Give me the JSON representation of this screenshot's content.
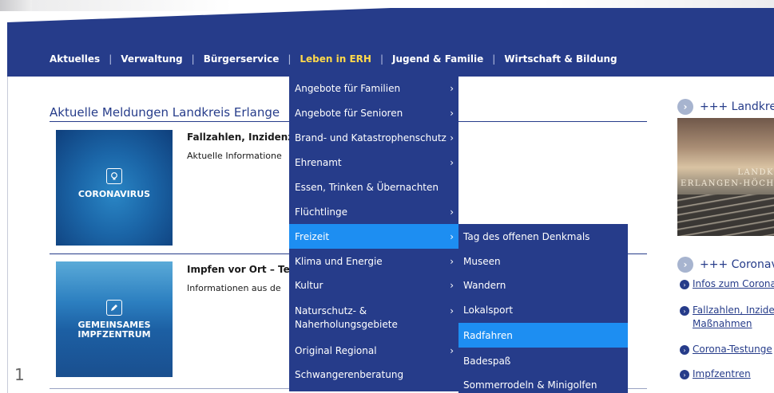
{
  "top_nav": {
    "items": [
      "Aktuelles",
      "Verwaltung",
      "Bürgerservice",
      "Leben in ERH",
      "Jugend & Familie",
      "Wirtschaft & Bildung"
    ],
    "active": "Leben in ERH",
    "separator": "|"
  },
  "main": {
    "heading": "Aktuelle Meldungen Landkreis Erlange",
    "news": [
      {
        "title": "Fallzahlen, Inzidenz",
        "text": "Aktuelle Informatione",
        "image_label": "CORONAVIRUS"
      },
      {
        "title": "Impfen vor Ort – Te",
        "text": "Informationen aus de",
        "image_label_line1": "GEMEINSAMES",
        "image_label_line2": "IMPFZENTRUM"
      }
    ],
    "page_number": "1"
  },
  "dropdown": {
    "items": [
      {
        "label": "Angebote für Familien",
        "arrow": "›"
      },
      {
        "label": "Angebote für Senioren",
        "arrow": "›"
      },
      {
        "label": "Brand- und Katastrophenschutz",
        "arrow": "›"
      },
      {
        "label": "Ehrenamt",
        "arrow": "›"
      },
      {
        "label": "Essen, Trinken & Übernachten",
        "arrow": ""
      },
      {
        "label": "Flüchtlinge",
        "arrow": "›"
      },
      {
        "label": "Freizeit",
        "arrow": "›"
      },
      {
        "label": "Klima und Energie",
        "arrow": "›"
      },
      {
        "label": "Kultur",
        "arrow": "›"
      },
      {
        "label": "Naturschutz- &",
        "label2": "Naherholungsgebiete",
        "arrow": "›"
      },
      {
        "label": "Original Regional",
        "arrow": "›"
      },
      {
        "label": "Schwangerenberatung",
        "arrow": ""
      }
    ],
    "highlighted": "Freizeit"
  },
  "submenu": {
    "items": [
      "Tag des offenen Denkmals",
      "Museen",
      "Wandern",
      "Lokalsport",
      "Radfahren",
      "Badespaß",
      "Sommerrodeln & Minigolfen"
    ],
    "highlighted": "Radfahren"
  },
  "right_column": {
    "heading1": "+++ Landkrei",
    "teaser_line1": "LANDK",
    "teaser_line2": "ERLANGEN-HÖCHS",
    "heading2": "+++ Coronavi",
    "links": [
      {
        "text": "Infos zum Corona"
      },
      {
        "text": "Fallzahlen, Inzide",
        "text2": "Maßnahmen"
      },
      {
        "text": "Corona-Testunge"
      },
      {
        "text": "Impfzentren"
      }
    ]
  },
  "colors": {
    "brand_blue": "#263c8a",
    "highlight_blue": "#1d8ef2",
    "active_nav_yellow": "#ffd94a"
  }
}
